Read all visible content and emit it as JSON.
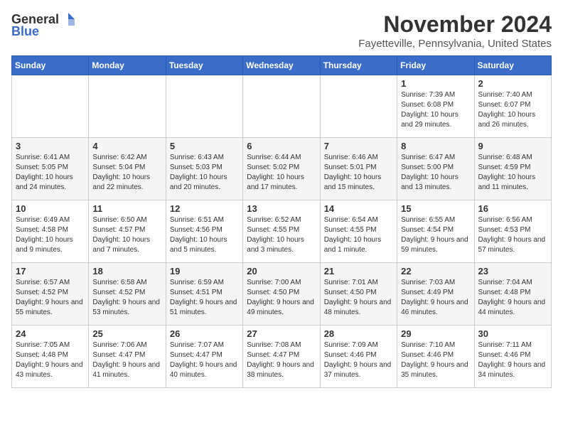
{
  "logo": {
    "general": "General",
    "blue": "Blue"
  },
  "title": "November 2024",
  "subtitle": "Fayetteville, Pennsylvania, United States",
  "days_of_week": [
    "Sunday",
    "Monday",
    "Tuesday",
    "Wednesday",
    "Thursday",
    "Friday",
    "Saturday"
  ],
  "weeks": [
    [
      {
        "day": "",
        "info": ""
      },
      {
        "day": "",
        "info": ""
      },
      {
        "day": "",
        "info": ""
      },
      {
        "day": "",
        "info": ""
      },
      {
        "day": "",
        "info": ""
      },
      {
        "day": "1",
        "info": "Sunrise: 7:39 AM\nSunset: 6:08 PM\nDaylight: 10 hours and 29 minutes."
      },
      {
        "day": "2",
        "info": "Sunrise: 7:40 AM\nSunset: 6:07 PM\nDaylight: 10 hours and 26 minutes."
      }
    ],
    [
      {
        "day": "3",
        "info": "Sunrise: 6:41 AM\nSunset: 5:05 PM\nDaylight: 10 hours and 24 minutes."
      },
      {
        "day": "4",
        "info": "Sunrise: 6:42 AM\nSunset: 5:04 PM\nDaylight: 10 hours and 22 minutes."
      },
      {
        "day": "5",
        "info": "Sunrise: 6:43 AM\nSunset: 5:03 PM\nDaylight: 10 hours and 20 minutes."
      },
      {
        "day": "6",
        "info": "Sunrise: 6:44 AM\nSunset: 5:02 PM\nDaylight: 10 hours and 17 minutes."
      },
      {
        "day": "7",
        "info": "Sunrise: 6:46 AM\nSunset: 5:01 PM\nDaylight: 10 hours and 15 minutes."
      },
      {
        "day": "8",
        "info": "Sunrise: 6:47 AM\nSunset: 5:00 PM\nDaylight: 10 hours and 13 minutes."
      },
      {
        "day": "9",
        "info": "Sunrise: 6:48 AM\nSunset: 4:59 PM\nDaylight: 10 hours and 11 minutes."
      }
    ],
    [
      {
        "day": "10",
        "info": "Sunrise: 6:49 AM\nSunset: 4:58 PM\nDaylight: 10 hours and 9 minutes."
      },
      {
        "day": "11",
        "info": "Sunrise: 6:50 AM\nSunset: 4:57 PM\nDaylight: 10 hours and 7 minutes."
      },
      {
        "day": "12",
        "info": "Sunrise: 6:51 AM\nSunset: 4:56 PM\nDaylight: 10 hours and 5 minutes."
      },
      {
        "day": "13",
        "info": "Sunrise: 6:52 AM\nSunset: 4:55 PM\nDaylight: 10 hours and 3 minutes."
      },
      {
        "day": "14",
        "info": "Sunrise: 6:54 AM\nSunset: 4:55 PM\nDaylight: 10 hours and 1 minute."
      },
      {
        "day": "15",
        "info": "Sunrise: 6:55 AM\nSunset: 4:54 PM\nDaylight: 9 hours and 59 minutes."
      },
      {
        "day": "16",
        "info": "Sunrise: 6:56 AM\nSunset: 4:53 PM\nDaylight: 9 hours and 57 minutes."
      }
    ],
    [
      {
        "day": "17",
        "info": "Sunrise: 6:57 AM\nSunset: 4:52 PM\nDaylight: 9 hours and 55 minutes."
      },
      {
        "day": "18",
        "info": "Sunrise: 6:58 AM\nSunset: 4:52 PM\nDaylight: 9 hours and 53 minutes."
      },
      {
        "day": "19",
        "info": "Sunrise: 6:59 AM\nSunset: 4:51 PM\nDaylight: 9 hours and 51 minutes."
      },
      {
        "day": "20",
        "info": "Sunrise: 7:00 AM\nSunset: 4:50 PM\nDaylight: 9 hours and 49 minutes."
      },
      {
        "day": "21",
        "info": "Sunrise: 7:01 AM\nSunset: 4:50 PM\nDaylight: 9 hours and 48 minutes."
      },
      {
        "day": "22",
        "info": "Sunrise: 7:03 AM\nSunset: 4:49 PM\nDaylight: 9 hours and 46 minutes."
      },
      {
        "day": "23",
        "info": "Sunrise: 7:04 AM\nSunset: 4:48 PM\nDaylight: 9 hours and 44 minutes."
      }
    ],
    [
      {
        "day": "24",
        "info": "Sunrise: 7:05 AM\nSunset: 4:48 PM\nDaylight: 9 hours and 43 minutes."
      },
      {
        "day": "25",
        "info": "Sunrise: 7:06 AM\nSunset: 4:47 PM\nDaylight: 9 hours and 41 minutes."
      },
      {
        "day": "26",
        "info": "Sunrise: 7:07 AM\nSunset: 4:47 PM\nDaylight: 9 hours and 40 minutes."
      },
      {
        "day": "27",
        "info": "Sunrise: 7:08 AM\nSunset: 4:47 PM\nDaylight: 9 hours and 38 minutes."
      },
      {
        "day": "28",
        "info": "Sunrise: 7:09 AM\nSunset: 4:46 PM\nDaylight: 9 hours and 37 minutes."
      },
      {
        "day": "29",
        "info": "Sunrise: 7:10 AM\nSunset: 4:46 PM\nDaylight: 9 hours and 35 minutes."
      },
      {
        "day": "30",
        "info": "Sunrise: 7:11 AM\nSunset: 4:46 PM\nDaylight: 9 hours and 34 minutes."
      }
    ]
  ]
}
